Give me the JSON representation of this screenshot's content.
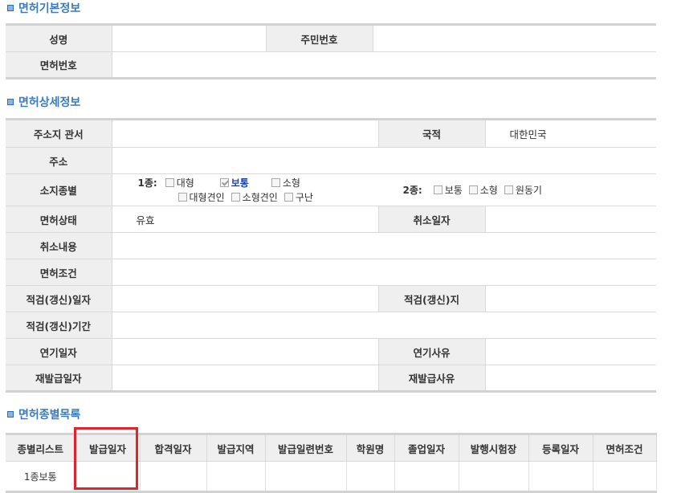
{
  "basic": {
    "title": "면허기본정보",
    "name_label": "성명",
    "name_value": "",
    "rrn_label": "주민번호",
    "rrn_value": "",
    "license_no_label": "면허번호",
    "license_no_value": ""
  },
  "detail": {
    "title": "면허상세정보",
    "office_label": "주소지 관서",
    "office_value": "",
    "nation_label": "국적",
    "nation_value": "대한민국",
    "address_label": "주소",
    "address_value": "",
    "class_label": "소지종별",
    "class1_label": "1종:",
    "class1_options": [
      {
        "label": "대형",
        "checked": false
      },
      {
        "label": "보통",
        "checked": true
      },
      {
        "label": "소형",
        "checked": false
      },
      {
        "label": "대형견인",
        "checked": false
      },
      {
        "label": "소형견인",
        "checked": false
      },
      {
        "label": "구난",
        "checked": false
      }
    ],
    "class2_label": "2종:",
    "class2_options": [
      {
        "label": "보통",
        "checked": false
      },
      {
        "label": "소형",
        "checked": false
      },
      {
        "label": "원동기",
        "checked": false
      }
    ],
    "status_label": "면허상태",
    "status_value": "유효",
    "cancel_date_label": "취소일자",
    "cancel_date_value": "",
    "cancel_content_label": "취소내용",
    "cancel_content_value": "",
    "condition_label": "면허조건",
    "condition_value": "",
    "inspect_date_label": "적검(갱신)일자",
    "inspect_date_value": "",
    "inspect_place_label": "적검(갱신)지",
    "inspect_place_value": "",
    "inspect_period_label": "적검(갱신)기간",
    "inspect_period_value": "",
    "postpone_date_label": "연기일자",
    "postpone_date_value": "",
    "postpone_reason_label": "연기사유",
    "postpone_reason_value": "",
    "reissue_date_label": "재발급일자",
    "reissue_date_value": "",
    "reissue_reason_label": "재발급사유",
    "reissue_reason_value": ""
  },
  "classes": {
    "title": "면허종별목록",
    "columns": [
      "종별리스트",
      "발급일자",
      "합격일자",
      "발급지역",
      "발급일련번호",
      "학원명",
      "졸업일자",
      "발행시험장",
      "등록일자",
      "면허조건"
    ],
    "rows": [
      [
        "1종보통",
        "",
        "",
        "",
        "",
        "",
        "",
        "",
        "",
        ""
      ]
    ]
  },
  "colors": {
    "section_title": "#3a7bbf",
    "label_bg": "#efefef",
    "status_green": "#1a8a1a",
    "selected_option": "#1a3fa8",
    "highlight_box": "#e0242b"
  }
}
